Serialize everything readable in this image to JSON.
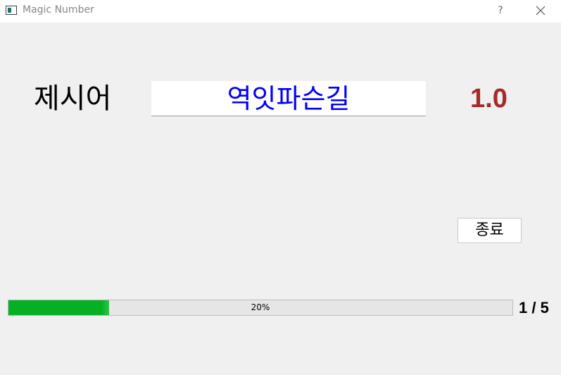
{
  "window": {
    "title": "Magic Number",
    "help_label": "?",
    "icon": "app-window-icon",
    "close_icon": "close-icon"
  },
  "main": {
    "name_label": "제시어",
    "word": "역잇파슨길",
    "score": "1.0",
    "exit_label": "종료"
  },
  "progress": {
    "value_percent": 20,
    "text": "20%",
    "counter": "1 / 5"
  },
  "colors": {
    "word_text": "#0000ff",
    "score_text": "#a52a2a",
    "progress_fill": "#06b025",
    "background": "#f0f0f0"
  }
}
